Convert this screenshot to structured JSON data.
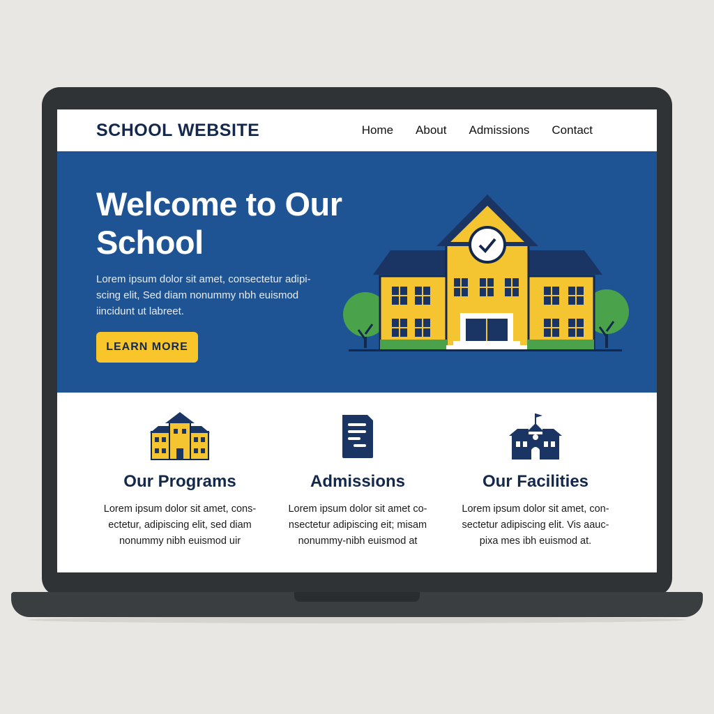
{
  "site": {
    "logo": "SCHOOL WEBSITE",
    "nav": [
      "Home",
      "About",
      "Admissions",
      "Contact"
    ]
  },
  "hero": {
    "title": "Welcome to Our School",
    "body": "Lorem ipsum dolor sit amet, consectetur adipi-scing elit, Sed diam nonummy nbh euismod iincidunt ut labreet.",
    "button": "LEARN MORE"
  },
  "features": [
    {
      "icon": "school-building-icon",
      "title": "Our Programs",
      "text": "Lorem ipsum dolor sit amet, cons-ectetur, adipiscing elit, sed diam nonummy nibh euismod uir"
    },
    {
      "icon": "document-icon",
      "title": "Admissions",
      "text": "Lorem ipsum dolor sit amet co-nsectetur adipiscing eit; misam nonummy-nibh euismod at"
    },
    {
      "icon": "schoolhouse-flag-icon",
      "title": "Our Facilities",
      "text": "Lorem ipsum dolor sit amet, con-sectetur adipiscing elit. Vis aauc-pixa mes ibh euismod at."
    }
  ],
  "colors": {
    "navy": "#13284b",
    "hero_blue": "#1f5494",
    "accent_yellow": "#f8c62b",
    "tree_green": "#4aa34a"
  }
}
